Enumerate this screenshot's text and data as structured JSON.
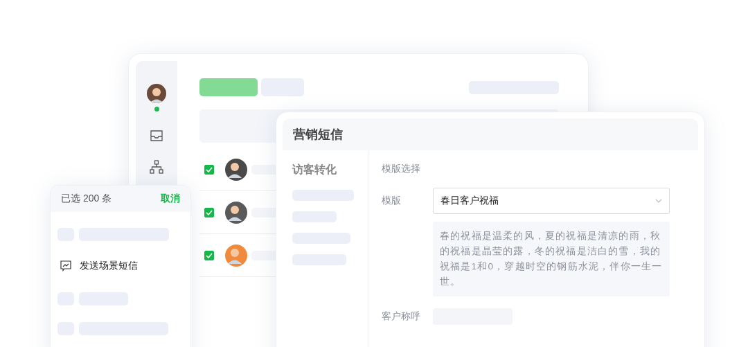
{
  "back_window": {
    "user_online": true,
    "rows": [
      {
        "checked": true,
        "color": "#4a4a4a"
      },
      {
        "checked": true,
        "color": "#5a5a5a"
      },
      {
        "checked": true,
        "color": "#f08a3c"
      }
    ]
  },
  "selection_panel": {
    "count_label": "已选 200 条",
    "cancel": "取消",
    "action": "发送场景短信"
  },
  "sms_window": {
    "title": "营销短信",
    "nav_title": "访客转化",
    "section": "模版选择",
    "template_label": "模版",
    "template_value": "春日客户祝福",
    "template_text": "春的祝福是温柔的风，夏的祝福是清凉的雨，秋的祝福是晶莹的露，冬的祝福是洁白的雪，我的祝福是1和0，穿越时空的钢筋水泥，伴你一生一世。",
    "salutation_label": "客户称呼"
  }
}
